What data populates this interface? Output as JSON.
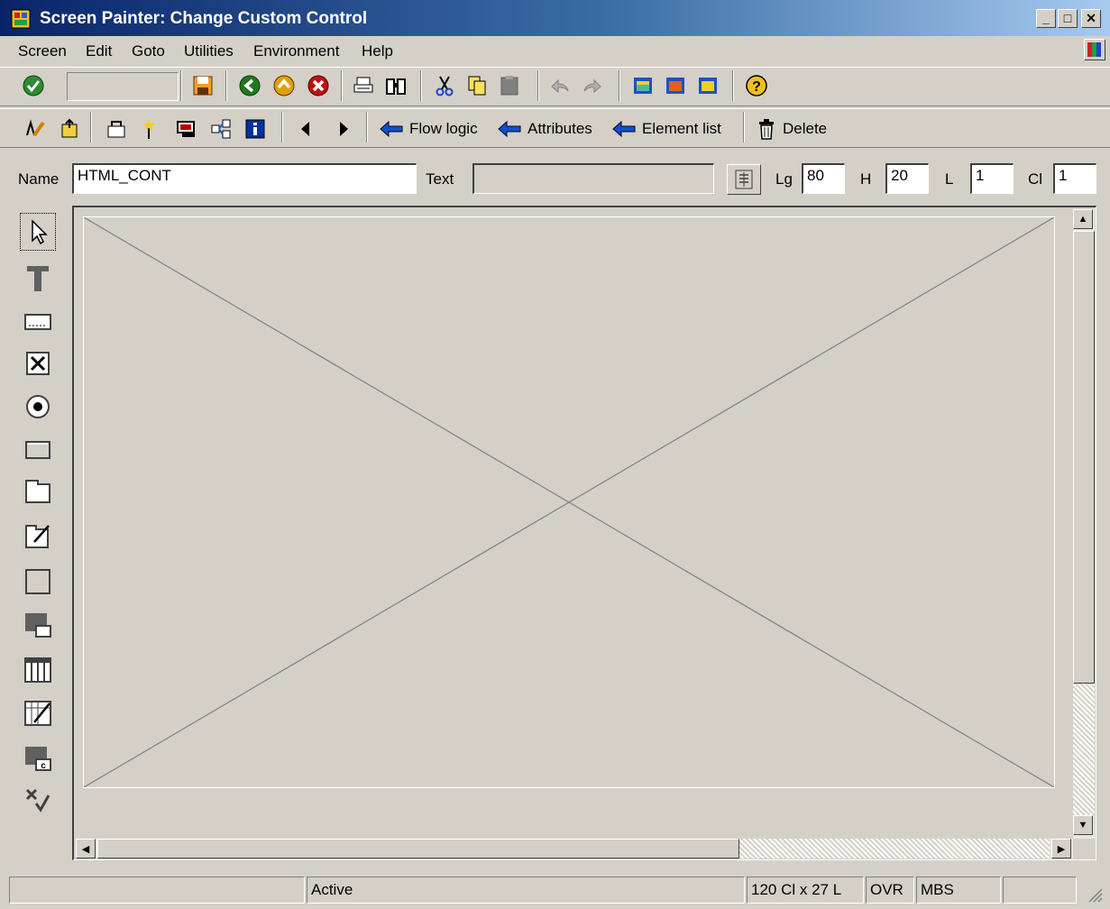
{
  "window": {
    "title": "Screen Painter: Change Custom Control"
  },
  "menu": [
    "Screen",
    "Edit",
    "Goto",
    "Utilities",
    "Environment",
    "Help"
  ],
  "app_toolbar": {
    "flow_logic": "Flow logic",
    "attributes": "Attributes",
    "element_list": "Element list",
    "delete": "Delete"
  },
  "fields": {
    "name_label": "Name",
    "name_value": "HTML_CONT",
    "text_label": "Text",
    "text_value": "",
    "lg_label": "Lg",
    "lg_value": "80",
    "h_label": "H",
    "h_value": "20",
    "l_label": "L",
    "l_value": "1",
    "cl_label": "Cl",
    "cl_value": "1"
  },
  "status_bar": {
    "message": "",
    "state": "Active",
    "size": "120 Cl x 27 L",
    "mode": "OVR",
    "system": "MBS",
    "extra": ""
  },
  "colors": {
    "title_start": "#0a246a",
    "title_end": "#a6caf0",
    "face": "#d4d0c8"
  }
}
